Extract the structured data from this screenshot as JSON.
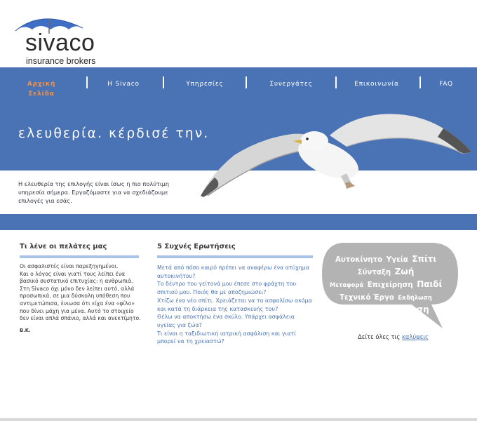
{
  "logo": {
    "name": "sivaco",
    "tagline": "insurance brokers",
    "icon": "umbrella-icon"
  },
  "nav": {
    "items": [
      {
        "label": "Αρχική Σελίδα",
        "active": true
      },
      {
        "label": "Η Sivaco",
        "active": false
      },
      {
        "label": "Υπηρεσίες",
        "active": false
      },
      {
        "label": "Συνεργάτες",
        "active": false
      },
      {
        "label": "Επικοινωνία",
        "active": false
      },
      {
        "label": "FAQ",
        "active": false
      }
    ]
  },
  "hero": {
    "title": "ελευθερία. κέρδισέ την.",
    "text": "Η ελευθερία της επιλογής είναι ίσως η πιο πολύτιμη υπηρεσία σήμερα. Εργαζόμαστε για να σχεδιάζουμε επιλογές για εσάς.",
    "image": "seagull-flying"
  },
  "testimonials": {
    "heading": "Τι λένε οι πελάτες μας",
    "paragraphs": [
      "Οι ασφαλιστές είναι παρεξηγημένοι.",
      "Και ο λόγος είναι γιατί τους λείπει ένα βασικό συστατικό επιτυχίας: η ανθρωπιά. Στη Sivaco όχι μόνο δεν λείπει αυτό, αλλά προσωπικά, σε μια δύσκολη υπόθεση που αντιμετώπισα, ένιωσα ότι είχα ένα «φίλο» που δίνει μάχη για μένα. Αυτό το στοιχείο δεν είναι απλά σπάνιο, αλλά και ανεκτίμητο."
    ],
    "signature": "Β.Κ."
  },
  "faq": {
    "heading": "5 Συχνές Ερωτήσεις",
    "questions": [
      "Μετά από πόσο καιρό πρέπει να αναφέρω ένα ατύχημα αυτοκινήτου?",
      "Το δέντρο του γείτονά μου έπεσε στο φράχτη του σπιτιού μου. Ποιός θα με αποζημιώσει?",
      "Χτίζω ένα νέο σπίτι. Χρειάζεται να το ασφαλίσω ακόμα και κατά τη διάρκεια της κατασκευής του?",
      "Θέλω να αποκτήσω ένα σκύλο. Υπάρχει ασφάλεια υγείας για ζώα?",
      "Τι είναι η ταξιδιωτική ιατρική ασφάλιση και γιατί μπορεί να τη χρειαστώ?"
    ]
  },
  "coverage_bubble": {
    "lines": [
      [
        {
          "t": "Αυτοκίνητο",
          "s": "m"
        },
        {
          "t": "Υγεία",
          "s": "m"
        },
        {
          "t": "Σπίτι",
          "s": "l"
        }
      ],
      [
        {
          "t": "Σύνταξη",
          "s": "m"
        },
        {
          "t": "Ζωή",
          "s": "l"
        }
      ],
      [
        {
          "t": "Μεταφορά",
          "s": "s"
        },
        {
          "t": "Επιχείρηση",
          "s": "m"
        },
        {
          "t": "Παιδί",
          "s": "l"
        }
      ],
      [
        {
          "t": "Τεχνικό Έργο",
          "s": "m"
        },
        {
          "t": "Εκδήλωση",
          "s": "s"
        }
      ],
      [
        {
          "t": "Ταξίδι",
          "s": "s"
        },
        {
          "t": "Αποταμίευση",
          "s": "l"
        }
      ]
    ],
    "caption_prefix": "Δείτε όλες τις",
    "caption_link": "καλύψεις"
  },
  "colors": {
    "brand_blue": "#4a73b5",
    "nav_active": "#f29048",
    "rule": "#a9c2e8",
    "bubble": "#b3b3b3"
  }
}
